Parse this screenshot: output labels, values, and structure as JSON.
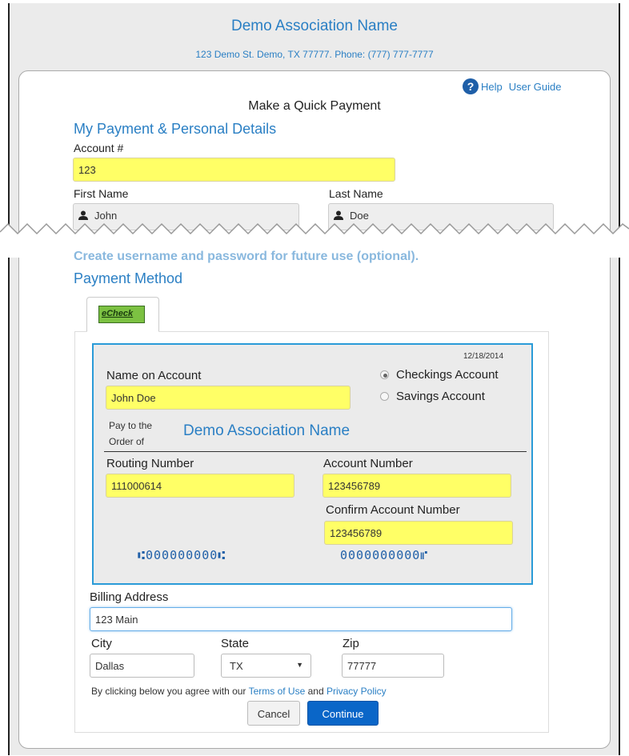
{
  "header": {
    "association_name": "Demo Association Name",
    "address_line": "123 Demo St. Demo, TX 77777. Phone: (777) 777-7777"
  },
  "help": {
    "help_label": "Help",
    "guide_label": "User Guide",
    "icon": "question-circle-icon"
  },
  "form": {
    "title": "Make a Quick Payment",
    "section_details": "My Payment & Personal Details",
    "account_label": "Account #",
    "account_value": "123",
    "first_name_label": "First Name",
    "first_name_value": "John",
    "last_name_label": "Last Name",
    "last_name_value": "Doe",
    "create_login_text": "Create username and password for future use (optional).",
    "section_payment": "Payment Method"
  },
  "tab": {
    "label": "eCheck"
  },
  "check": {
    "date": "12/18/2014",
    "name_label": "Name on Account",
    "name_value": "John Doe",
    "checking_label": "Checkings Account",
    "savings_label": "Savings Account",
    "selected_type": "checking",
    "pay_to_line1": "Pay to the",
    "pay_to_line2": "Order of",
    "payee": "Demo Association Name",
    "routing_label": "Routing Number",
    "routing_value": "111000614",
    "account_number_label": "Account Number",
    "account_number_value": "123456789",
    "confirm_label": "Confirm Account Number",
    "confirm_value": "123456789",
    "micr_routing": "⑆000000000⑆",
    "micr_account": "0000000000⑈"
  },
  "billing": {
    "address_label": "Billing Address",
    "address_value": "123 Main",
    "city_label": "City",
    "city_value": "Dallas",
    "state_label": "State",
    "state_value": "TX",
    "zip_label": "Zip",
    "zip_value": "77777"
  },
  "agreement": {
    "prefix": "By clicking below you agree with our",
    "terms": "Terms of Use",
    "and": "and",
    "privacy": "Privacy Policy"
  },
  "buttons": {
    "cancel": "Cancel",
    "continue": "Continue"
  },
  "colors": {
    "accent": "#2a7fc4",
    "highlight": "#ffff66",
    "primary_button": "#0a66c8"
  }
}
